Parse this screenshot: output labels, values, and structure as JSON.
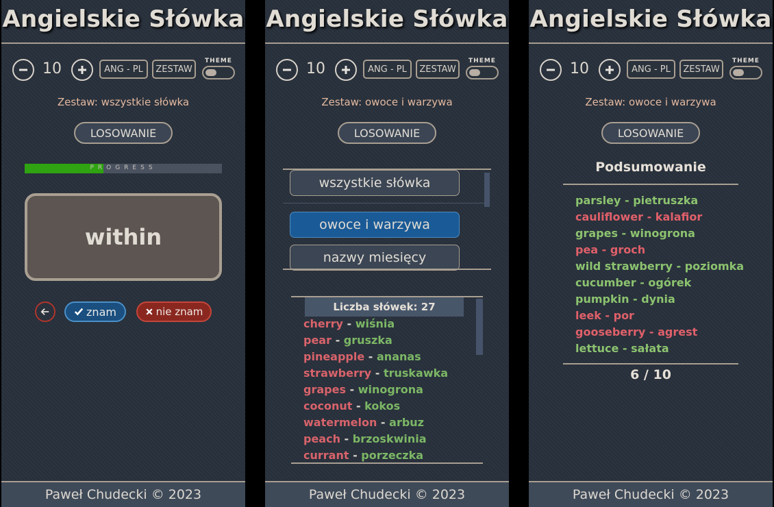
{
  "app": {
    "title": "Angielskie Słówka",
    "count": "10",
    "mode_label": "ANG - PL",
    "set_button": "ZESTAW",
    "theme_label": "THEME",
    "draw_button": "LOSOWANIE",
    "footer": "Paweł Chudecki © 2023"
  },
  "panel1": {
    "set_label": "Zestaw: wszystkie słówka",
    "progress_label": "PROGRESS",
    "progress_fraction": 0.4,
    "word": "within",
    "back_icon": "arrow-left-icon",
    "know_label": "znam",
    "dont_know_label": "nie znam"
  },
  "panel2": {
    "set_label": "Zestaw: owoce i warzywa",
    "sets": [
      "wszystkie słówka",
      "owoce i warzywa",
      "nazwy miesięcy"
    ],
    "active_set": "owoce i warzywa",
    "count_label": "Liczba słówek: 27",
    "words": [
      {
        "en": "cherry",
        "pl": "wiśnia"
      },
      {
        "en": "pear",
        "pl": "gruszka"
      },
      {
        "en": "pineapple",
        "pl": "ananas"
      },
      {
        "en": "strawberry",
        "pl": "truskawka"
      },
      {
        "en": "grapes",
        "pl": "winogrona"
      },
      {
        "en": "coconut",
        "pl": "kokos"
      },
      {
        "en": "watermelon",
        "pl": "arbuz"
      },
      {
        "en": "peach",
        "pl": "brzoskwinia"
      },
      {
        "en": "currant",
        "pl": "porzeczka"
      }
    ]
  },
  "panel3": {
    "set_label": "Zestaw: owoce i warzywa",
    "summary_title": "Podsumowanie",
    "results": [
      {
        "text": "parsley - pietruszka",
        "status": "good"
      },
      {
        "text": "cauliflower - kalafior",
        "status": "bad"
      },
      {
        "text": "grapes - winogrona",
        "status": "good"
      },
      {
        "text": "pea - groch",
        "status": "bad"
      },
      {
        "text": "wild strawberry - poziomka",
        "status": "good"
      },
      {
        "text": "cucumber - ogórek",
        "status": "good"
      },
      {
        "text": "pumpkin - dynia",
        "status": "good"
      },
      {
        "text": "leek - por",
        "status": "bad"
      },
      {
        "text": "gooseberry - agrest",
        "status": "bad"
      },
      {
        "text": "lettuce - sałata",
        "status": "good"
      }
    ],
    "score": "6 / 10"
  },
  "colors": {
    "panel_bg": "#28303b",
    "accent_border": "#a99f92",
    "progress_green": "#2fa311",
    "know_blue": "#1a4f80",
    "dont_know_red": "#8a2820",
    "word_en_red": "#d9636b",
    "word_pl_green": "#7cb765"
  }
}
